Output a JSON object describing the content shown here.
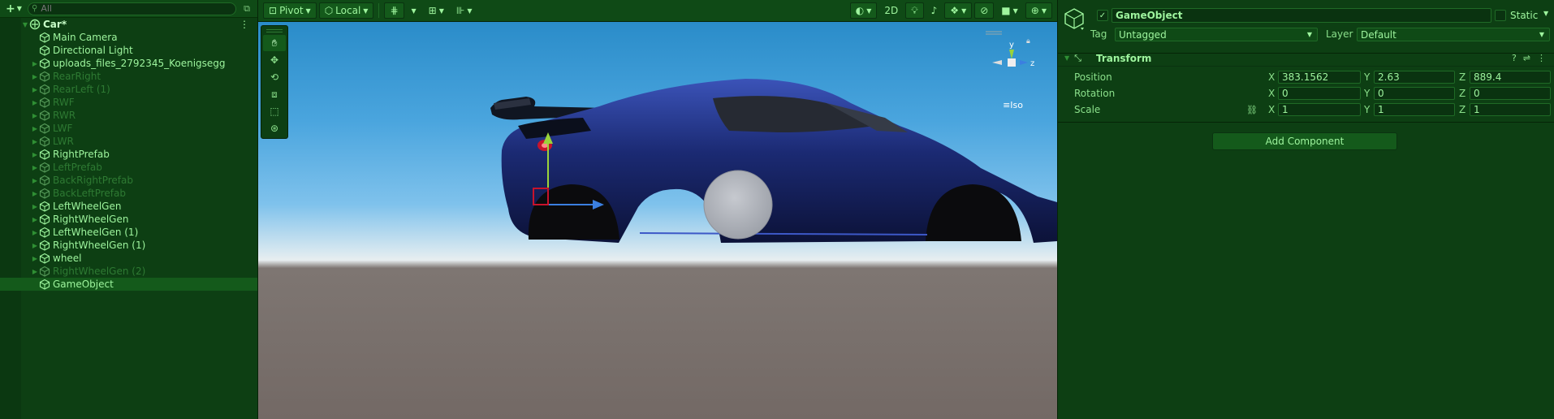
{
  "hierarchy": {
    "search_placeholder": "All",
    "add_label": "+",
    "root": "Car*",
    "items": [
      {
        "label": "Main Camera",
        "dim": false,
        "expandable": false
      },
      {
        "label": "Directional Light",
        "dim": false,
        "expandable": false
      },
      {
        "label": "uploads_files_2792345_Koenigsegg",
        "dim": false,
        "expandable": true
      },
      {
        "label": "RearRight",
        "dim": true,
        "expandable": true
      },
      {
        "label": "RearLeft (1)",
        "dim": true,
        "expandable": true
      },
      {
        "label": "RWF",
        "dim": true,
        "expandable": true
      },
      {
        "label": "RWR",
        "dim": true,
        "expandable": true
      },
      {
        "label": "LWF",
        "dim": true,
        "expandable": true
      },
      {
        "label": "LWR",
        "dim": true,
        "expandable": true
      },
      {
        "label": "RightPrefab",
        "dim": false,
        "expandable": true
      },
      {
        "label": "LeftPrefab",
        "dim": true,
        "expandable": true
      },
      {
        "label": "BackRightPrefab",
        "dim": true,
        "expandable": true
      },
      {
        "label": "BackLeftPrefab",
        "dim": true,
        "expandable": true
      },
      {
        "label": "LeftWheelGen",
        "dim": false,
        "expandable": true
      },
      {
        "label": "RightWheelGen",
        "dim": false,
        "expandable": true
      },
      {
        "label": "LeftWheelGen (1)",
        "dim": false,
        "expandable": true
      },
      {
        "label": "RightWheelGen (1)",
        "dim": false,
        "expandable": true
      },
      {
        "label": "wheel",
        "dim": false,
        "expandable": true
      },
      {
        "label": "RightWheelGen (2)",
        "dim": true,
        "expandable": true
      },
      {
        "label": "GameObject",
        "dim": false,
        "expandable": false,
        "selected": true
      }
    ]
  },
  "scene_toolbar": {
    "pivot": "Pivot",
    "local": "Local",
    "mode_2d": "2D"
  },
  "gizmo": {
    "y": "y",
    "z": "z",
    "projection": "Iso"
  },
  "inspector": {
    "name": "GameObject",
    "static_label": "Static",
    "tag_label": "Tag",
    "tag_value": "Untagged",
    "layer_label": "Layer",
    "layer_value": "Default",
    "transform_title": "Transform",
    "position_label": "Position",
    "rotation_label": "Rotation",
    "scale_label": "Scale",
    "axis_x": "X",
    "axis_y": "Y",
    "axis_z": "Z",
    "position": {
      "x": "383.1562",
      "y": "2.63",
      "z": "889.4"
    },
    "rotation": {
      "x": "0",
      "y": "0",
      "z": "0"
    },
    "scale": {
      "x": "1",
      "y": "1",
      "z": "1"
    },
    "add_component": "Add Component"
  },
  "colors": {
    "accent": "#9ef59e",
    "panel": "#0d3f13",
    "gizmo_y": "#9bd33a",
    "gizmo_z": "#3b7fe0",
    "car_body": "#1b2a73"
  }
}
